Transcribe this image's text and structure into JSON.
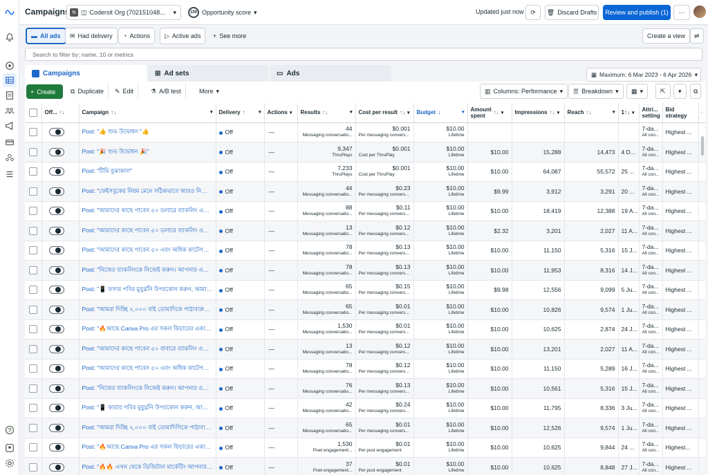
{
  "topbar": {
    "title": "Campaigns",
    "account_badge": "N",
    "account_label": "Codersit Org (702151048...",
    "score_value": "100",
    "score_label": "Opportunity score",
    "updated": "Updated just now",
    "discard_label": "Discard Drafts",
    "publish_label": "Review and publish (1)",
    "more_label": "···"
  },
  "chips": [
    {
      "label": "All ads",
      "icon": "folder-icon"
    },
    {
      "label": "Had delivery",
      "icon": "delivery-icon"
    },
    {
      "label": "Actions",
      "icon": "actions-icon"
    },
    {
      "label": "Active ads",
      "icon": "play-icon"
    },
    {
      "label": "See more",
      "icon": "plus-icon"
    }
  ],
  "create_view_label": "Create a view",
  "search": {
    "placeholder": "Search to filter by: name, 10 or metrics"
  },
  "tabs": [
    {
      "label": "Campaigns",
      "icon": "campaigns-icon"
    },
    {
      "label": "Ad sets",
      "icon": "adsets-icon"
    },
    {
      "label": "Ads",
      "icon": "ads-icon"
    }
  ],
  "date_range": "Maximum: 6 Mar 2023 - 6 Apr 2026",
  "toolbar": {
    "create": "Create",
    "duplicate": "Duplicate",
    "edit": "Edit",
    "ab_test": "A/B test",
    "more": "More",
    "columns": "Columns: Performance",
    "breakdown": "Breakdown"
  },
  "columns": {
    "off": "Off...",
    "campaign": "Campaign",
    "delivery": "Delivery",
    "actions": "Actions",
    "results": "Results",
    "cpr": "Cost per result",
    "budget": "Budget",
    "amount_spent_1": "Amount",
    "amount_spent_2": "spent",
    "impressions": "Impressions",
    "reach": "Reach",
    "freq": "1↑↓",
    "attr_1": "Attri...",
    "attr_2": "setting",
    "bid_1": "Bid",
    "bid_2": "strategy"
  },
  "rows": [
    {
      "name": "Post: \"👍 শুভ উদ্বোধন \"👍",
      "delivery": "Off",
      "actions": "—",
      "results": "44",
      "results_sub": "Messaging conversatio...",
      "cpr": "$0.001",
      "cpr_sub": "Per messaging convers...",
      "budget": "$10.00",
      "budget_sub": "Lifetime",
      "spent": "",
      "impressions": "",
      "reach": "",
      "date": "",
      "attr": "7-da...",
      "attr_sub": "All con...",
      "bid": "Highest ..."
    },
    {
      "name": "Post: \"🎉 শুভ উদ্বোধন 🎉\"",
      "delivery": "Off",
      "actions": "—",
      "results": "9,347",
      "results_sub": "ThruPlays",
      "cpr": "$0.001",
      "cpr_sub": "Cost per ThruPlay",
      "budget": "$10.00",
      "budget_sub": "Lifetime",
      "spent": "$10.00",
      "impressions": "15,288",
      "reach": "14,473",
      "date": "4 D...",
      "attr": "7-da...",
      "attr_sub": "All con...",
      "bid": "Highest ..."
    },
    {
      "name": "Post: \"টিমি বুঝাকাল\"",
      "delivery": "Off",
      "actions": "—",
      "results": "7,233",
      "results_sub": "ThruPlays",
      "cpr": "$0.001",
      "cpr_sub": "Cost per ThruPlay",
      "budget": "$10.00",
      "budget_sub": "Lifetime",
      "spent": "$10.00",
      "impressions": "64,087",
      "reach": "55,572",
      "date": "25 ...",
      "attr": "7-da...",
      "attr_sub": "All con...",
      "bid": "Highest ..."
    },
    {
      "name": "Post: \"ফেইসবুকের নিয়ম মেনে সঠিকভাবে আরও নিতে পার...",
      "delivery": "Off",
      "actions": "—",
      "results": "44",
      "results_sub": "Messaging conversatio...",
      "cpr": "$0.23",
      "cpr_sub": "Per messaging convers...",
      "budget": "$10.00",
      "budget_sub": "Lifetime",
      "spent": "$9.99",
      "impressions": "3,912",
      "reach": "3,291",
      "date": "20 ...",
      "attr": "7-da...",
      "attr_sub": "All con...",
      "bid": "Highest ..."
    },
    {
      "name": "Post: \"আমাদের কাছে পাবেন ৫০ ডলারে ব্যাকলিং এবেব...",
      "delivery": "Off",
      "actions": "—",
      "results": "88",
      "results_sub": "Messaging conversatio...",
      "cpr": "$0.11",
      "cpr_sub": "Per messaging convers...",
      "budget": "$10.00",
      "budget_sub": "Lifetime",
      "spent": "$10.00",
      "impressions": "18,419",
      "reach": "12,388",
      "date": "19 A...",
      "attr": "7-da...",
      "attr_sub": "All con...",
      "bid": "Highest ..."
    },
    {
      "name": "Post: \"আমাদের কাছে পাবেন ৫০ ডলারে ব্যাকলিং ওবেব...",
      "delivery": "Off",
      "actions": "—",
      "results": "13",
      "results_sub": "Messaging conversatio...",
      "cpr": "$0.12",
      "cpr_sub": "Per messaging convers...",
      "budget": "$10.00",
      "budget_sub": "Lifetime",
      "spent": "$2.32",
      "impressions": "3,201",
      "reach": "2,027",
      "date": "11 A...",
      "attr": "7-da...",
      "attr_sub": "All con...",
      "bid": "Highest ..."
    },
    {
      "name": "Post: \"আমাদের কাছে পাবেন ৫০ এবং অধিক কাটেগরিতে ৪...",
      "delivery": "Off",
      "actions": "—",
      "results": "78",
      "results_sub": "Messaging conversatio...",
      "cpr": "$0.13",
      "cpr_sub": "Per messaging convers...",
      "budget": "$10.00",
      "budget_sub": "Lifetime",
      "spent": "$10.00",
      "impressions": "11,150",
      "reach": "5,316",
      "date": "15 J...",
      "attr": "7-da...",
      "attr_sub": "All con...",
      "bid": "Highest ..."
    },
    {
      "name": "Post: \"নিজের ব্যাকলিংকে নিজেই করুন। আপনার একোনাই...",
      "delivery": "Off",
      "actions": "—",
      "results": "78",
      "results_sub": "Messaging conversatio...",
      "cpr": "$0.13",
      "cpr_sub": "Per messaging convers...",
      "budget": "$10.00",
      "budget_sub": "Lifetime",
      "spent": "$10.00",
      "impressions": "11,953",
      "reach": "8,316",
      "date": "14 J...",
      "attr": "7-da...",
      "attr_sub": "All con...",
      "bid": "Highest ..."
    },
    {
      "name": "Post: \"📱 ফসার পবির মুবুর্থ্রনি উপরকোন করুন, আমাদের...",
      "delivery": "Off",
      "actions": "—",
      "results": "65",
      "results_sub": "Messaging conversatio...",
      "cpr": "$0.15",
      "cpr_sub": "Per messaging convers...",
      "budget": "$10.00",
      "budget_sub": "Lifetime",
      "spent": "$9.98",
      "impressions": "12,556",
      "reach": "9,099",
      "date": "5 Ju...",
      "attr": "7-da...",
      "attr_sub": "All con...",
      "bid": "Highest ..."
    },
    {
      "name": "Post: \"আমরা দিচ্ছি ২,০০০ বাই তোমাদিকে পাঠাবারুল ফু-স...",
      "delivery": "Off",
      "actions": "—",
      "results": "65",
      "results_sub": "Messaging conversatio...",
      "cpr": "$0.01",
      "cpr_sub": "Per messaging convers...",
      "budget": "$10.00",
      "budget_sub": "Lifetime",
      "spent": "$10.00",
      "impressions": "10,826",
      "reach": "9,574",
      "date": "1 Ju...",
      "attr": "7-da...",
      "attr_sub": "All con...",
      "bid": "Highest ..."
    },
    {
      "name": "Post: \"🔥আছে Canva Pro এর সকল ফিচারের একান দিকেন...",
      "delivery": "Off",
      "actions": "—",
      "results": "1,530",
      "results_sub": "Messaging conversatio...",
      "cpr": "$0.01",
      "cpr_sub": "Per messaging convers...",
      "budget": "$10.00",
      "budget_sub": "Lifetime",
      "spent": "$10.00",
      "impressions": "10,625",
      "reach": "2,874",
      "date": "24 J...",
      "attr": "7-da...",
      "attr_sub": "All con...",
      "bid": "Highest ..."
    },
    {
      "name": "Post: \"আমাদের কাছে পাবেন ৫০ বাবারে ব্যাকলিং ওবেব...",
      "delivery": "Off",
      "actions": "—",
      "results": "13",
      "results_sub": "Messaging conversatio...",
      "cpr": "$0.12",
      "cpr_sub": "Per messaging convers...",
      "budget": "$10.00",
      "budget_sub": "Lifetime",
      "spent": "$10.00",
      "impressions": "13,201",
      "reach": "2,027",
      "date": "11 A...",
      "attr": "7-da...",
      "attr_sub": "All con...",
      "bid": "Highest ..."
    },
    {
      "name": "Post: \"আমাদের কাছে পাবেন ৫০ এবং অধিক কাটেগরিতে |...",
      "delivery": "Off",
      "actions": "—",
      "results": "78",
      "results_sub": "Messaging conversatio...",
      "cpr": "$0.12",
      "cpr_sub": "Per messaging convers...",
      "budget": "$10.00",
      "budget_sub": "Lifetime",
      "spent": "$10.00",
      "impressions": "11,150",
      "reach": "5,289",
      "date": "16 J...",
      "attr": "7-da...",
      "attr_sub": "All con...",
      "bid": "Highest ..."
    },
    {
      "name": "Post: \"নিজের ব্যাকলিংকে নিজেই করুন। আপনার ওবেবসাইট...",
      "delivery": "Off",
      "actions": "—",
      "results": "76",
      "results_sub": "Messaging conversatio...",
      "cpr": "$0.13",
      "cpr_sub": "Per messaging convers...",
      "budget": "$10.00",
      "budget_sub": "Lifetime",
      "spent": "$10.00",
      "impressions": "10,561",
      "reach": "5,316",
      "date": "15 J...",
      "attr": "7-da...",
      "attr_sub": "All con...",
      "bid": "Highest ..."
    },
    {
      "name": "Post: \"📱 কারার পবির মুবুর্থ্রনি উপরকোন করুন, আমাদে...",
      "delivery": "Off",
      "actions": "—",
      "results": "42",
      "results_sub": "Messaging conversatio...",
      "cpr": "$0.24",
      "cpr_sub": "Per messaging convers...",
      "budget": "$10.00",
      "budget_sub": "Lifetime",
      "spent": "$10.00",
      "impressions": "11,795",
      "reach": "8,336",
      "date": "3 Ju...",
      "attr": "7-da...",
      "attr_sub": "All con...",
      "bid": "Highest ..."
    },
    {
      "name": "Post: \"আমরা দিচ্ছি ২,০০০ বাই তোমাদিগিকে পাঠাবারুল ফু-স...",
      "delivery": "Off",
      "actions": "—",
      "results": "65",
      "results_sub": "Messaging conversatio...",
      "cpr": "$0.01",
      "cpr_sub": "Per messaging convers...",
      "budget": "$10.00",
      "budget_sub": "Lifetime",
      "spent": "$10.00",
      "impressions": "12,526",
      "reach": "9,574",
      "date": "1 Ju...",
      "attr": "7-da...",
      "attr_sub": "All con...",
      "bid": "Highest ..."
    },
    {
      "name": "Post: \"🔥আছে Canva Pro এর সকল ফিচারের একান দিকেন...",
      "delivery": "Off",
      "actions": "—",
      "results": "1,530",
      "results_sub": "Poet engagement...",
      "cpr": "$0.01",
      "cpr_sub": "Per post engagement",
      "budget": "$10.00",
      "budget_sub": "Lifetime",
      "spent": "$10.00",
      "impressions": "10,625",
      "reach": "9,844",
      "date": "24 ...",
      "attr": "7-da...",
      "attr_sub": "All con...",
      "bid": "Highest..."
    },
    {
      "name": "Post: \"🔥🔥 এখন থেকে ডিজিটাল মার্কেটিং আপনার লেক্সে",
      "delivery": "Off",
      "actions": "—",
      "results": "37",
      "results_sub": "Poet engagement...",
      "cpr": "$0.01",
      "cpr_sub": "Per post engagement",
      "budget": "$10.00",
      "budget_sub": "Lifetime",
      "spent": "$10.00",
      "impressions": "10,625",
      "reach": "8,848",
      "date": "27 J...",
      "attr": "7-da...",
      "attr_sub": "All con...",
      "bid": "Highest ..."
    }
  ],
  "colors": {
    "accent": "#1d67c8",
    "primary": "#0a66d6",
    "create": "#1f7a3c"
  }
}
